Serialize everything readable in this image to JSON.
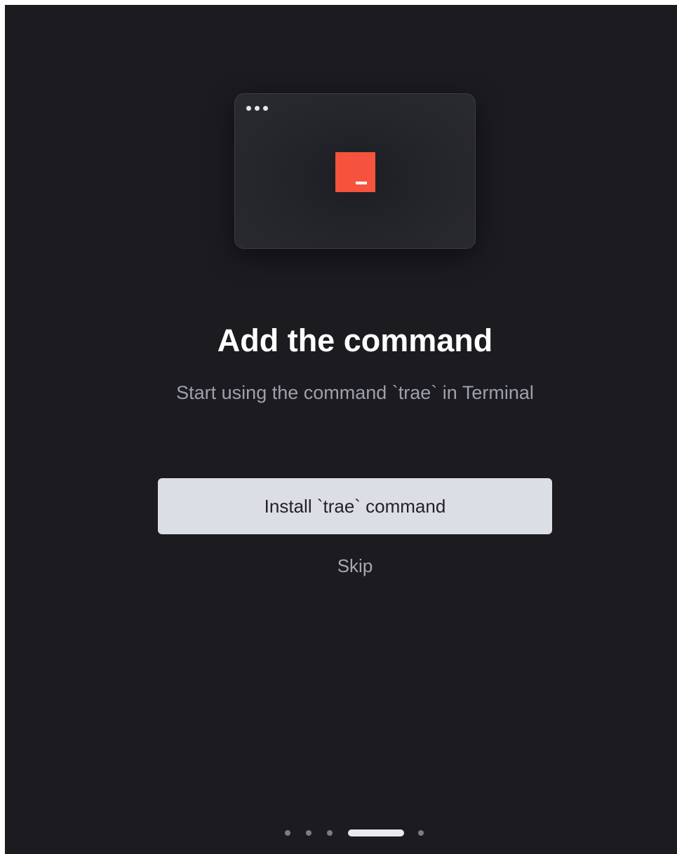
{
  "onboarding": {
    "title": "Add the command",
    "subtitle": "Start using the command `trae` in Terminal",
    "install_button_label": "Install `trae` command",
    "skip_label": "Skip"
  },
  "illustration": {
    "icon": "terminal-icon",
    "window_controls_icon": "window-dots-icon",
    "accent_color": "#f5533d"
  },
  "pagination": {
    "total_steps": 5,
    "current_step": 4
  },
  "colors": {
    "background": "#1b1b20",
    "button_background": "#dcdee6",
    "subtitle": "#9ea0ac"
  }
}
